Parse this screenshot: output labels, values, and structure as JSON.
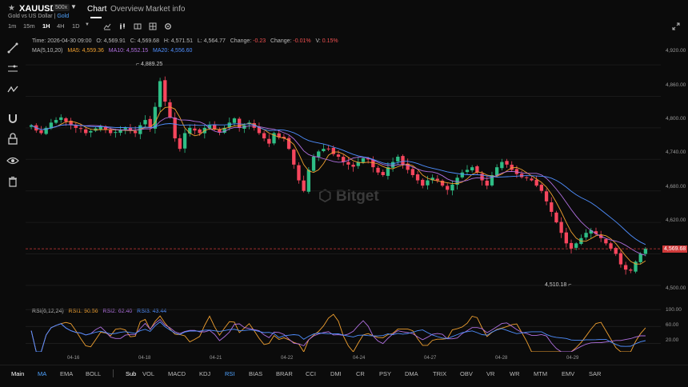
{
  "header": {
    "symbol": "XAUUSD",
    "leverage_badge": "500x",
    "subtitle_prefix": "Gold vs US Dollar",
    "subtitle_sep": " | ",
    "subtitle_link": "Gold",
    "tabs": [
      "Chart",
      "Overview",
      "Market info"
    ],
    "active_tab": "Chart"
  },
  "intervals": [
    "1m",
    "15m",
    "1H",
    "4H",
    "1D"
  ],
  "active_interval": "1H",
  "info": {
    "time_label": "Time:",
    "time": "2026-04-30 09:00",
    "open_label": "O:",
    "open": "4,569.91",
    "close_label": "C:",
    "close": "4,569.68",
    "high_label": "H:",
    "high": "4,571.51",
    "low_label": "L:",
    "low": "4,564.77",
    "change_label": "Change:",
    "change": "-0.23",
    "change_pct_label": "Change:",
    "change_pct": "-0.01%",
    "volatility_label": "V:",
    "volatility": "0.15%"
  },
  "ma": {
    "label": "MA(5,10,20)",
    "ma5": "MA5: 4,559.36",
    "ma10": "MA10: 4,552.15",
    "ma20": "MA20: 4,556.60"
  },
  "rsi": {
    "label": "RSI(6,12,24)",
    "rsi1": "RSI1: 90.56",
    "rsi2": "RSI2: 62.40",
    "rsi3": "RSI3: 43.44"
  },
  "price_axis": [
    "4,920.00",
    "4,860.00",
    "4,800.00",
    "4,740.00",
    "4,680.00",
    "4,620.00",
    "4,500.00"
  ],
  "current_price": "4,569.68",
  "rsi_axis": [
    "100.00",
    "60.00",
    "20.00"
  ],
  "x_axis": [
    "04-16",
    "04-18",
    "04-21",
    "04-22",
    "04-24",
    "04-27",
    "04-28",
    "04-29"
  ],
  "annotations": {
    "high": "4,889.25",
    "low": "4,510.18"
  },
  "watermark": "Bitget",
  "bottom_bar": {
    "main_label": "Main",
    "main_items": [
      "MA",
      "EMA",
      "BOLL"
    ],
    "sub_label": "Sub",
    "sub_items": [
      "VOL",
      "MACD",
      "KDJ",
      "RSI",
      "BIAS",
      "BRAR",
      "CCI",
      "DMI",
      "CR",
      "PSY",
      "DMA",
      "TRIX",
      "OBV",
      "VR",
      "WR",
      "MTM",
      "EMV",
      "SAR"
    ],
    "active_main": "MA",
    "active_sub": "RSI"
  },
  "colors": {
    "up": "#2ebd85",
    "down": "#f6465d",
    "ma5": "#f0a030",
    "ma10": "#b070e0",
    "ma20": "#4f8fff",
    "accent": "#4fa3ff"
  },
  "chart_data": {
    "type": "candlestick",
    "price_range": [
      4480,
      4940
    ],
    "rsi_range": [
      0,
      110
    ],
    "series_close": [
      4805,
      4795,
      4790,
      4800,
      4810,
      4815,
      4820,
      4812,
      4805,
      4800,
      4798,
      4790,
      4794,
      4799,
      4803,
      4797,
      4790,
      4792,
      4797,
      4800,
      4795,
      4790,
      4805,
      4815,
      4800,
      4840,
      4889,
      4850,
      4820,
      4780,
      4760,
      4790,
      4800,
      4795,
      4790,
      4800,
      4805,
      4798,
      4792,
      4800,
      4810,
      4818,
      4800,
      4805,
      4810,
      4800,
      4790,
      4780,
      4770,
      4790,
      4782,
      4780,
      4760,
      4730,
      4700,
      4680,
      4720,
      4745,
      4755,
      4760,
      4760,
      4750,
      4745,
      4735,
      4730,
      4726,
      4735,
      4742,
      4740,
      4725,
      4715,
      4710,
      4725,
      4735,
      4745,
      4730,
      4720,
      4710,
      4700,
      4690,
      4700,
      4705,
      4700,
      4690,
      4682,
      4692,
      4705,
      4715,
      4720,
      4725,
      4715,
      4700,
      4690,
      4710,
      4725,
      4735,
      4730,
      4720,
      4712,
      4706,
      4705,
      4700,
      4690,
      4680,
      4660,
      4640,
      4620,
      4600,
      4580,
      4570,
      4580,
      4590,
      4600,
      4605,
      4598,
      4590,
      4580,
      4570,
      4560,
      4540,
      4530,
      4528,
      4545,
      4560,
      4570
    ]
  }
}
